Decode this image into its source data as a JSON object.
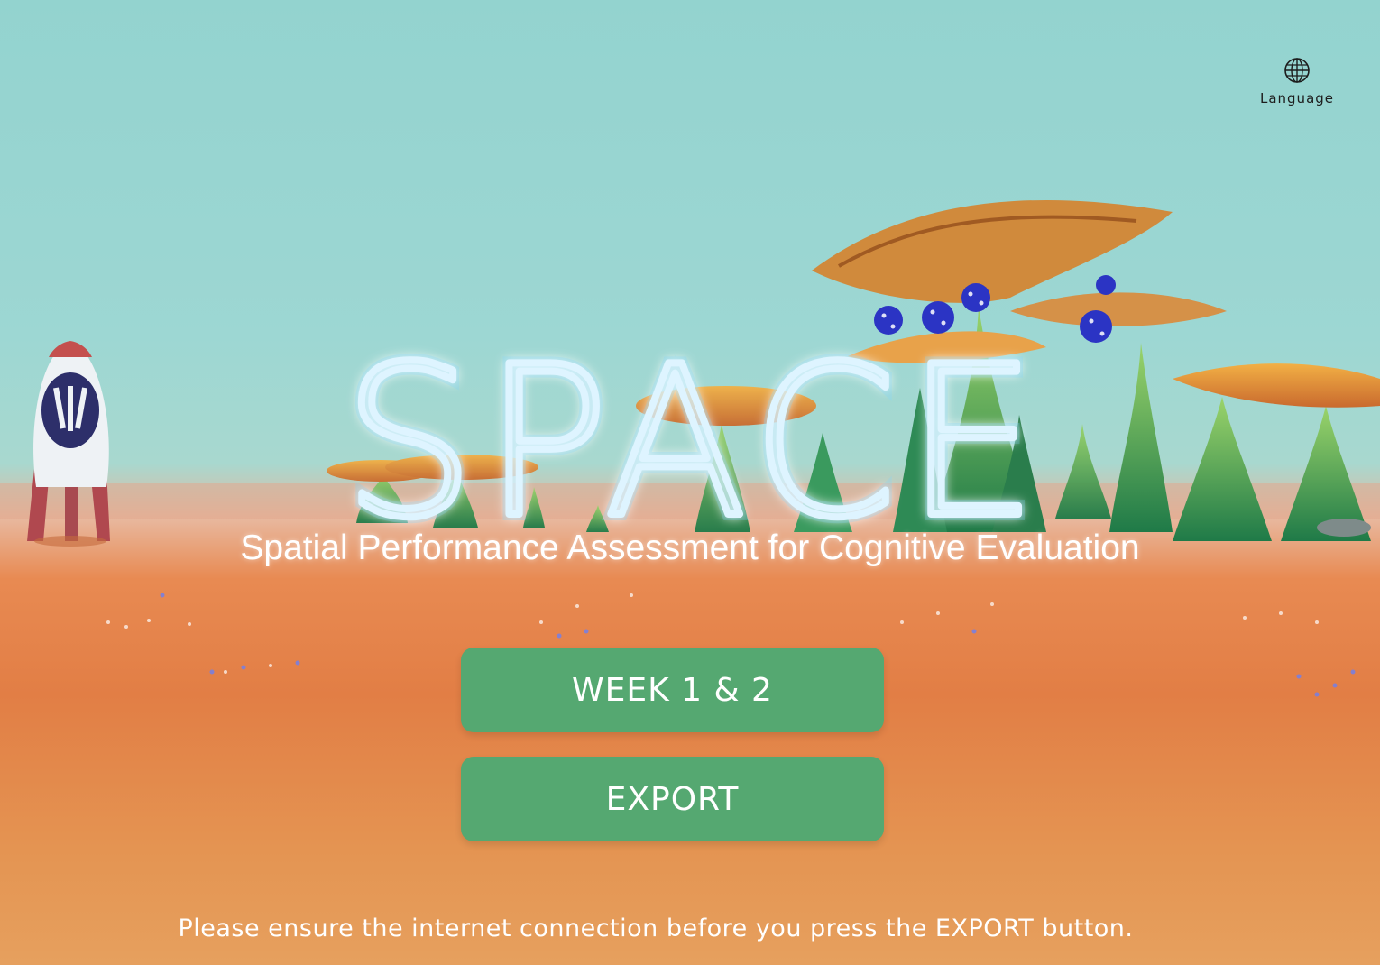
{
  "language": {
    "label": "Language",
    "icon": "globe-icon"
  },
  "title": {
    "logo_text": "SPACE",
    "subtitle": "Spatial Performance Assessment for Cognitive Evaluation"
  },
  "buttons": {
    "week_label": "WEEK 1 & 2",
    "export_label": "EXPORT"
  },
  "notice": "Please ensure the internet connection before you press the EXPORT button.",
  "colors": {
    "sky": "#93d3cf",
    "ground": "#e27e45",
    "button": "#55a871",
    "title_glow": "#7fd6ff"
  }
}
